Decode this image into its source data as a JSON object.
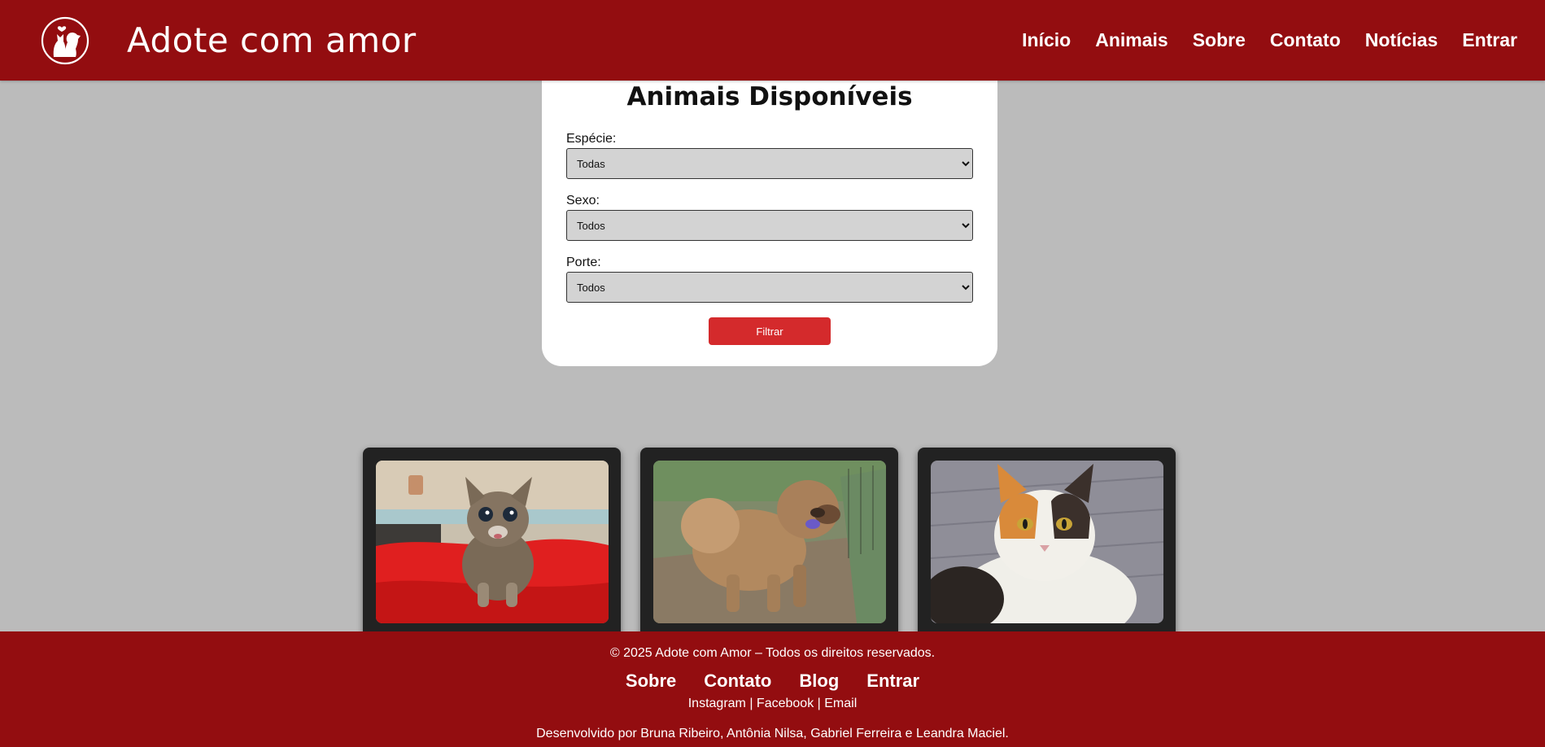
{
  "colors": {
    "brand": "#930d10",
    "background": "#bbbbbb",
    "card": "#ffffff",
    "button": "#d42a2c",
    "animal_card": "#222222"
  },
  "header": {
    "logo_icon": "pets-heart-logo-icon",
    "title": "Adote com amor",
    "nav": [
      "Início",
      "Animais",
      "Sobre",
      "Contato",
      "Notícias",
      "Entrar"
    ]
  },
  "filter": {
    "title": "Animais Disponíveis",
    "fields": [
      {
        "label": "Espécie:",
        "value": "Todas"
      },
      {
        "label": "Sexo:",
        "value": "Todos"
      },
      {
        "label": "Porte:",
        "value": "Todos"
      }
    ],
    "button_label": "Filtrar"
  },
  "animals": [
    {
      "photo": "tabby-kitten-photo"
    },
    {
      "photo": "chow-chow-dog-photo"
    },
    {
      "photo": "calico-cat-photo"
    }
  ],
  "footer": {
    "copyright": "© 2025 Adote com Amor – Todos os direitos reservados.",
    "nav": [
      "Sobre",
      "Contato",
      "Blog",
      "Entrar"
    ],
    "social": [
      "Instagram",
      "Facebook",
      "Email"
    ],
    "social_separator": " | ",
    "credits": "Desenvolvido por Bruna Ribeiro, Antônia Nilsa, Gabriel Ferreira e Leandra Maciel."
  }
}
